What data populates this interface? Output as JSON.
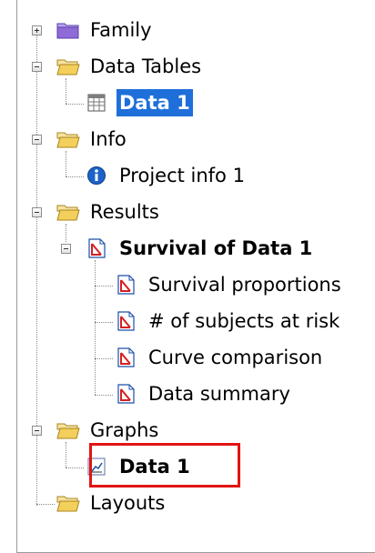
{
  "tree": {
    "family": {
      "label": "Family",
      "icon": "folder-purple-icon"
    },
    "data_tables": {
      "label": "Data Tables",
      "icon": "folder-open-icon",
      "children": [
        {
          "label": "Data 1",
          "icon": "data-table-icon",
          "selected": true
        }
      ]
    },
    "info": {
      "label": "Info",
      "icon": "folder-open-icon",
      "children": [
        {
          "label": "Project info 1",
          "icon": "info-icon"
        }
      ]
    },
    "results": {
      "label": "Results",
      "icon": "folder-open-icon",
      "survival": {
        "label": "Survival of Data 1",
        "icon": "results-sheet-icon",
        "children": [
          {
            "label": "Survival proportions",
            "icon": "results-sheet-icon"
          },
          {
            "label": "# of subjects at risk",
            "icon": "results-sheet-icon"
          },
          {
            "label": "Curve comparison",
            "icon": "results-sheet-icon"
          },
          {
            "label": "Data summary",
            "icon": "results-sheet-icon"
          }
        ]
      }
    },
    "graphs": {
      "label": "Graphs",
      "icon": "folder-open-icon",
      "children": [
        {
          "label": "Data 1",
          "icon": "graph-icon",
          "highlighted": true
        }
      ]
    },
    "layouts": {
      "label": "Layouts",
      "icon": "folder-open-icon"
    }
  },
  "colors": {
    "selection": "#1e6fd9",
    "highlight_border": "#e11414",
    "folder_yellow": "#f3cf5b",
    "folder_purple": "#8f6bd8",
    "info_blue": "#1c63c9",
    "sheet_red": "#d42020"
  }
}
